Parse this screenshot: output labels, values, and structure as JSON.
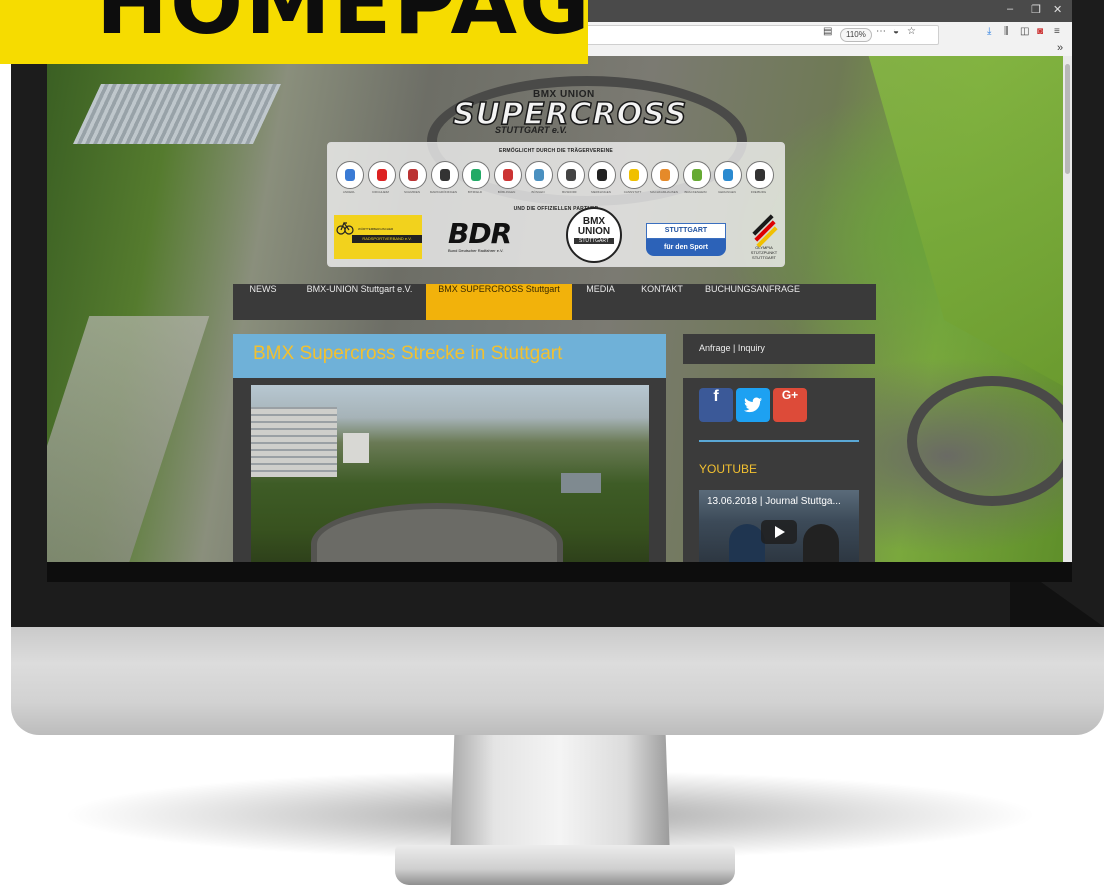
{
  "banner": {
    "text": "HOMEPAGE"
  },
  "browser": {
    "zoom": "110%",
    "window_controls": [
      "–",
      "❐",
      "✕"
    ],
    "toolbar_icons": [
      "reader-icon",
      "more-icon",
      "pocket-icon",
      "bookmark-star-icon",
      "download-icon",
      "library-icon",
      "sidebar-icon",
      "extension-icon",
      "menu-icon"
    ],
    "overflow": "»"
  },
  "site": {
    "logo": {
      "small": "BMX UNION",
      "big": "SUPERCROSS",
      "city": "STUTTGART e.V."
    },
    "sponsors": {
      "heading_clubs": "ERMÖGLICHT DURCH DIE TRÄGERVEREINE",
      "heading_partners": "UND DIE OFFIZIELLEN PARTNER",
      "clubs": [
        "ANDERL",
        "KIRCHHEIM",
        "SCHMIDEN",
        "MARKGRÖNINGEN",
        "BITZFELD",
        "BÖBLINGEN",
        "BÖNGEN",
        "BUSDORF",
        "MERKLINGEN",
        "CANNSTATT",
        "MACHKAMHAUSEN",
        "BRACKENHEIM",
        "GERLINGEN",
        "FREIBURG"
      ],
      "partners": {
        "wrv_top": "WÜRTTEMBERGISCHER",
        "wrv_band": "RADSPORTVERBAND e.V.",
        "bdr": "BDR",
        "bdr_sub": "Bund Deutscher Radfahrer e.V.",
        "bmx_l1": "BMX",
        "bmx_l2": "UNION",
        "bmx_l3": "STUTTGART",
        "stuttgart_top": "STUTTGART",
        "stuttgart_bottom": "für den Sport",
        "olympia": "OLYMPIA STÜTZPUNKT STUTTGART"
      }
    },
    "nav": [
      "NEWS",
      "BMX-UNION Stuttgart e.V.",
      "BMX SUPERCROSS Stuttgart",
      "MEDIA",
      "KONTAKT",
      "BUCHUNGSANFRAGE"
    ],
    "nav_active_index": 2,
    "page_title": "BMX Supercross Strecke in Stuttgart",
    "sidebar": {
      "head": "Anfrage | Inquiry",
      "social": [
        "f",
        "t",
        "G+"
      ],
      "youtube_title": "YOUTUBE",
      "video_title": "13.06.2018 | Journal Stuttga..."
    }
  },
  "colors": {
    "banner": "#f6dc00",
    "nav_active": "#f2b20b",
    "title_bar": "#6fb1d8",
    "title_text": "#f2c030"
  }
}
